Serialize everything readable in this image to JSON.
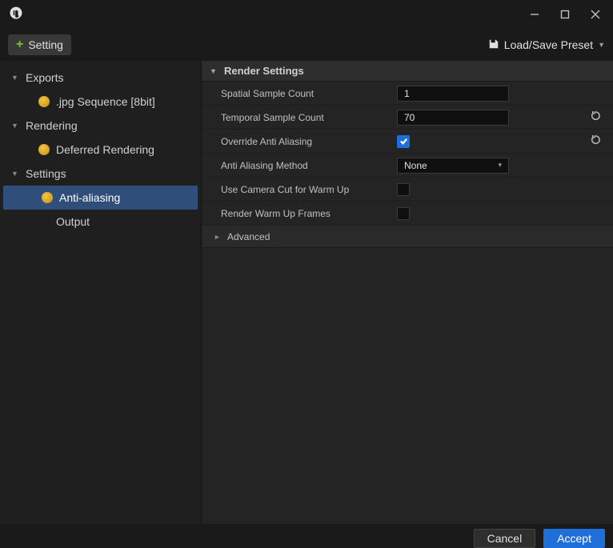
{
  "toolbar": {
    "setting_label": "Setting",
    "preset_label": "Load/Save Preset"
  },
  "sidebar": {
    "groups": [
      {
        "label": "Exports",
        "items": [
          {
            "label": ".jpg Sequence [8bit]"
          }
        ]
      },
      {
        "label": "Rendering",
        "items": [
          {
            "label": "Deferred Rendering"
          }
        ]
      },
      {
        "label": "Settings",
        "items": [
          {
            "label": "Anti-aliasing",
            "selected": true
          },
          {
            "label": "Output"
          }
        ]
      }
    ]
  },
  "panel": {
    "section_title": "Render Settings",
    "rows": {
      "spatial": {
        "label": "Spatial Sample Count",
        "value": "1"
      },
      "temporal": {
        "label": "Temporal Sample Count",
        "value": "70",
        "reset": true
      },
      "override_aa": {
        "label": "Override Anti Aliasing",
        "checked": true,
        "reset": true
      },
      "aa_method": {
        "label": "Anti Aliasing Method",
        "value": "None"
      },
      "camera_cut": {
        "label": "Use Camera Cut for Warm Up",
        "checked": false
      },
      "render_warm": {
        "label": "Render Warm Up Frames",
        "checked": false
      }
    },
    "advanced_label": "Advanced"
  },
  "footer": {
    "cancel": "Cancel",
    "accept": "Accept"
  }
}
